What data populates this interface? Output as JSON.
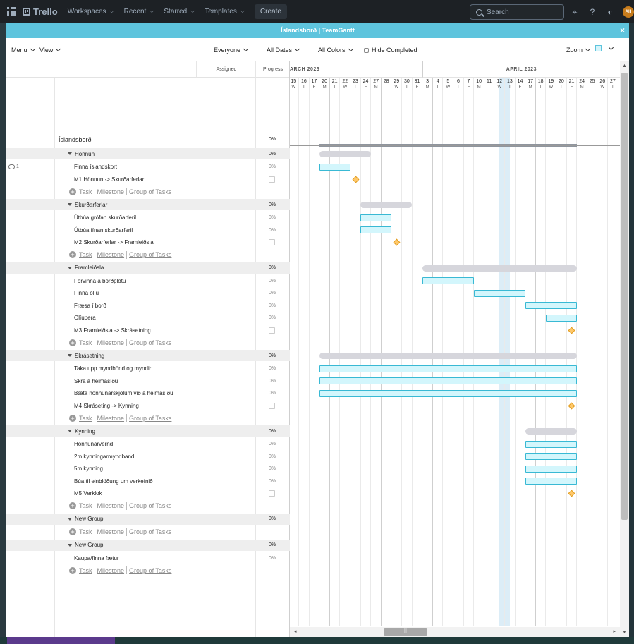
{
  "topbar": {
    "brand": "Trello",
    "nav": [
      "Workspaces",
      "Recent",
      "Starred",
      "Templates"
    ],
    "create": "Create",
    "search_placeholder": "Search",
    "avatar": "AH"
  },
  "modal": {
    "title": "Íslandsborð | TeamGantt",
    "close": "×"
  },
  "toolbar": {
    "menu": "Menu",
    "view": "View",
    "everyone": "Everyone",
    "all_dates": "All Dates",
    "all_colors": "All Colors",
    "hide_completed": "Hide Completed",
    "zoom": "Zoom"
  },
  "columns": {
    "assigned": "Assigned",
    "progress": "Progress"
  },
  "add_links": {
    "task": "Task",
    "milestone": "Milestone",
    "group": "Group of Tasks"
  },
  "project": {
    "name": "Íslandsborð",
    "progress": "0%"
  },
  "rows": [
    {
      "type": "group",
      "name": "Hönnun",
      "progress": "0%"
    },
    {
      "type": "task",
      "name": "Finna íslandskort",
      "progress": "0%",
      "comments": "1"
    },
    {
      "type": "milestone",
      "name": "M1 Hönnun -> Skurðarferlar"
    },
    {
      "type": "add"
    },
    {
      "type": "group",
      "name": "Skurðarferlar",
      "progress": "0%"
    },
    {
      "type": "task",
      "name": "Útbúa grófan skurðarferil",
      "progress": "0%"
    },
    {
      "type": "task",
      "name": "Útbúa fínan skurðarferil",
      "progress": "0%"
    },
    {
      "type": "milestone",
      "name": "M2 Skurðarferlar -> Framleiðsla"
    },
    {
      "type": "add"
    },
    {
      "type": "group",
      "name": "Framleiðsla",
      "progress": "0%"
    },
    {
      "type": "task",
      "name": "Forvinna á borðplötu",
      "progress": "0%"
    },
    {
      "type": "task",
      "name": "Finna olíu",
      "progress": "0%"
    },
    {
      "type": "task",
      "name": "Fræsa í borð",
      "progress": "0%"
    },
    {
      "type": "task",
      "name": "Olíubera",
      "progress": "0%"
    },
    {
      "type": "milestone",
      "name": "M3 Framleiðsla -> Skrásetning"
    },
    {
      "type": "add"
    },
    {
      "type": "group",
      "name": "Skrásetning",
      "progress": "0%"
    },
    {
      "type": "task",
      "name": "Taka upp myndbönd og myndir",
      "progress": "0%"
    },
    {
      "type": "task",
      "name": "Skrá á heimasíðu",
      "progress": "0%"
    },
    {
      "type": "task",
      "name": "Bæta hönnunarskjölum við á heimasíðu",
      "progress": "0%"
    },
    {
      "type": "milestone",
      "name": "M4 Skráseting -> Kynning"
    },
    {
      "type": "add"
    },
    {
      "type": "group",
      "name": "Kynning",
      "progress": "0%"
    },
    {
      "type": "task",
      "name": "Hönnunarvernd",
      "progress": "0%"
    },
    {
      "type": "task",
      "name": "2m kynningarmyndband",
      "progress": "0%"
    },
    {
      "type": "task",
      "name": "5m kynning",
      "progress": "0%"
    },
    {
      "type": "task",
      "name": "Búa til einblöðung um verkefnið",
      "progress": "0%"
    },
    {
      "type": "milestone",
      "name": "M5 Verklok"
    },
    {
      "type": "add"
    },
    {
      "type": "group",
      "name": "New Group",
      "progress": "0%"
    },
    {
      "type": "add"
    },
    {
      "type": "group",
      "name": "New Group",
      "progress": "0%"
    },
    {
      "type": "task",
      "name": "Kaupa/finna fætur",
      "progress": "0%"
    },
    {
      "type": "add"
    }
  ],
  "timeline": {
    "months": [
      {
        "label": "ARCH 2023",
        "startIndex": 0
      },
      {
        "label": "APRIL 2023",
        "startIndex": 13
      }
    ],
    "days": [
      {
        "d": "15",
        "w": "W"
      },
      {
        "d": "16",
        "w": "T"
      },
      {
        "d": "17",
        "w": "F"
      },
      {
        "d": "20",
        "w": "M"
      },
      {
        "d": "21",
        "w": "T"
      },
      {
        "d": "22",
        "w": "W"
      },
      {
        "d": "23",
        "w": "T"
      },
      {
        "d": "24",
        "w": "F"
      },
      {
        "d": "27",
        "w": "M"
      },
      {
        "d": "28",
        "w": "T"
      },
      {
        "d": "29",
        "w": "W"
      },
      {
        "d": "30",
        "w": "T"
      },
      {
        "d": "31",
        "w": "F"
      },
      {
        "d": "3",
        "w": "M"
      },
      {
        "d": "4",
        "w": "T"
      },
      {
        "d": "5",
        "w": "W"
      },
      {
        "d": "6",
        "w": "T"
      },
      {
        "d": "7",
        "w": "F"
      },
      {
        "d": "10",
        "w": "M"
      },
      {
        "d": "11",
        "w": "T"
      },
      {
        "d": "12",
        "w": "W"
      },
      {
        "d": "13",
        "w": "T"
      },
      {
        "d": "14",
        "w": "F"
      },
      {
        "d": "17",
        "w": "M"
      },
      {
        "d": "18",
        "w": "T"
      },
      {
        "d": "19",
        "w": "W"
      },
      {
        "d": "20",
        "w": "T"
      },
      {
        "d": "21",
        "w": "F"
      },
      {
        "d": "24",
        "w": "M"
      },
      {
        "d": "25",
        "w": "T"
      },
      {
        "d": "26",
        "w": "W"
      },
      {
        "d": "27",
        "w": "T"
      }
    ],
    "todayIndex": 20,
    "bars": [
      {
        "row": 0,
        "kind": "group",
        "start": 3,
        "end": 7
      },
      {
        "row": 1,
        "kind": "task",
        "start": 3,
        "end": 5
      },
      {
        "row": 2,
        "kind": "milestone",
        "at": 6
      },
      {
        "row": 4,
        "kind": "group",
        "start": 7,
        "end": 11
      },
      {
        "row": 5,
        "kind": "task",
        "start": 7,
        "end": 9
      },
      {
        "row": 6,
        "kind": "task",
        "start": 7,
        "end": 9
      },
      {
        "row": 7,
        "kind": "milestone",
        "at": 10
      },
      {
        "row": 9,
        "kind": "group",
        "start": 13,
        "end": 27
      },
      {
        "row": 10,
        "kind": "task",
        "start": 13,
        "end": 17
      },
      {
        "row": 11,
        "kind": "task",
        "start": 18,
        "end": 22
      },
      {
        "row": 12,
        "kind": "task",
        "start": 23,
        "end": 27
      },
      {
        "row": 13,
        "kind": "task",
        "start": 25,
        "end": 27
      },
      {
        "row": 14,
        "kind": "milestone",
        "at": 27
      },
      {
        "row": 16,
        "kind": "group",
        "start": 3,
        "end": 27
      },
      {
        "row": 17,
        "kind": "task",
        "start": 3,
        "end": 27
      },
      {
        "row": 18,
        "kind": "task",
        "start": 3,
        "end": 27
      },
      {
        "row": 19,
        "kind": "task",
        "start": 3,
        "end": 27
      },
      {
        "row": 20,
        "kind": "milestone",
        "at": 27
      },
      {
        "row": 22,
        "kind": "group",
        "start": 23,
        "end": 27
      },
      {
        "row": 23,
        "kind": "task",
        "start": 23,
        "end": 27
      },
      {
        "row": 24,
        "kind": "task",
        "start": 23,
        "end": 27
      },
      {
        "row": 25,
        "kind": "task",
        "start": 23,
        "end": 27
      },
      {
        "row": 26,
        "kind": "task",
        "start": 23,
        "end": 27
      },
      {
        "row": 27,
        "kind": "milestone",
        "at": 27
      }
    ],
    "projectBar": {
      "start": 3,
      "end": 27
    }
  }
}
